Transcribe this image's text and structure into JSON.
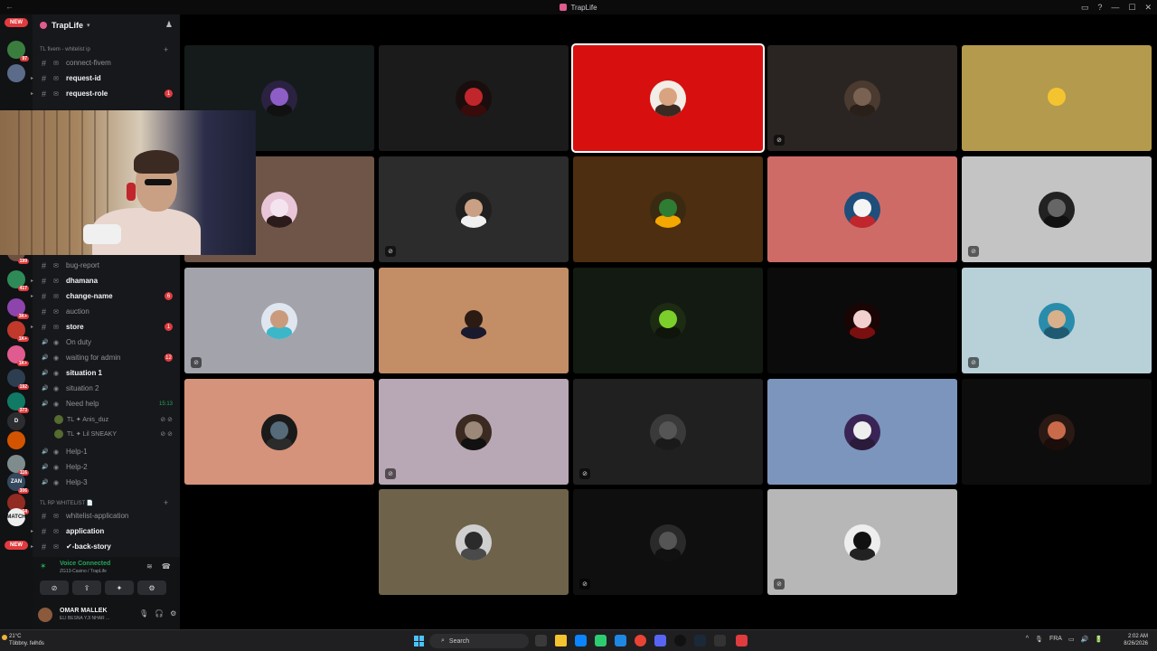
{
  "window": {
    "title": "TrapLife",
    "controls": [
      "▭",
      "?",
      "—",
      "☐",
      "✕"
    ],
    "back": "←"
  },
  "rail": {
    "new_top": "NEW",
    "new_bottom": "NEW",
    "servers": [
      {
        "badge": "97",
        "color": "#3b7d3e"
      },
      {
        "badge": "",
        "color": "#5b6b8a"
      },
      {
        "badge": "199",
        "color": "#6e5040"
      },
      {
        "badge": "417",
        "color": "#2e8b57"
      },
      {
        "badge": "3K+",
        "color": "#8e44ad"
      },
      {
        "badge": "1K+",
        "color": "#c0392b"
      },
      {
        "badge": "1K+",
        "color": "#e05b8f"
      },
      {
        "badge": "192",
        "color": "#2c3e50"
      },
      {
        "badge": "373",
        "color": "#117a65"
      },
      {
        "badge": "",
        "color": "#2b2d31",
        "label": "D"
      },
      {
        "badge": "",
        "color": "#d35400"
      },
      {
        "badge": "116",
        "color": "#7f8c8d"
      },
      {
        "badge": "306",
        "color": "#34495e",
        "label": "ZAN"
      },
      {
        "badge": "64",
        "color": "#922b21"
      },
      {
        "badge": "",
        "color": "#eee",
        "label": "MATCH"
      },
      {
        "badge": "160",
        "color": "#1e8449"
      }
    ]
  },
  "server": {
    "name": "TrapLife",
    "chevron": "▾",
    "add_member_icon": "♟"
  },
  "channels": [
    {
      "kind": "cat",
      "label": "TL fivem - whitelist ip",
      "plus": "+"
    },
    {
      "kind": "ch",
      "label": "connect-fivem",
      "bold": false,
      "ping": ""
    },
    {
      "kind": "ch",
      "label": "request-id",
      "bold": true,
      "ping": ""
    },
    {
      "kind": "ch",
      "label": "request-role",
      "bold": true,
      "ping": "1"
    },
    {
      "kind": "ch",
      "label": "bug-report",
      "bold": false,
      "ping": ""
    },
    {
      "kind": "ch",
      "label": "dhamana",
      "bold": true,
      "ping": ""
    },
    {
      "kind": "ch",
      "label": "change-name",
      "bold": true,
      "ping": "6"
    },
    {
      "kind": "ch",
      "label": "auction",
      "bold": false,
      "ping": ""
    },
    {
      "kind": "ch",
      "label": "store",
      "bold": true,
      "ping": "1"
    },
    {
      "kind": "voice",
      "label": "On duty",
      "bold": false,
      "ping": ""
    },
    {
      "kind": "voice",
      "label": "waiting for admin",
      "bold": false,
      "ping": "12"
    },
    {
      "kind": "voice",
      "label": "situation 1",
      "bold": true,
      "ping": ""
    },
    {
      "kind": "voice",
      "label": "situation 2",
      "bold": false,
      "ping": ""
    },
    {
      "kind": "voice",
      "label": "Need help",
      "bold": false,
      "ping": "",
      "timer": "15:13"
    },
    {
      "kind": "vuser",
      "label": "TL ✦ Anis_duz"
    },
    {
      "kind": "vuser",
      "label": "TL ✦ Lil SNEAKY"
    },
    {
      "kind": "voice",
      "label": "Help-1",
      "bold": false,
      "ping": ""
    },
    {
      "kind": "voice",
      "label": "Help-2",
      "bold": false,
      "ping": ""
    },
    {
      "kind": "voice",
      "label": "Help-3",
      "bold": false,
      "ping": ""
    },
    {
      "kind": "cat",
      "label": "TL RP WHITELIST 📄",
      "plus": "+"
    },
    {
      "kind": "ch",
      "label": "whitelist-application",
      "bold": false,
      "ping": ""
    },
    {
      "kind": "ch",
      "label": "application",
      "bold": true,
      "ping": ""
    },
    {
      "kind": "ch",
      "label": "✔-back-story",
      "bold": true,
      "ping": ""
    }
  ],
  "voice_panel": {
    "status": "Voice Connected",
    "location": "ZG13-Casino / TrapLife",
    "buttons": [
      "⊘",
      "⇪",
      "✦",
      "⚙"
    ]
  },
  "user": {
    "name": "OMAR MALLEK",
    "status": "ELI BESNA YJI NHAR ..."
  },
  "tiles": [
    {
      "bg": "#151b1a",
      "av1": "#2b2140",
      "av2": "#8e5ec7",
      "av3": "#111",
      "video": false,
      "speaking": false
    },
    {
      "bg": "#1b1b1b",
      "av1": "#1a0d0d",
      "av2": "#c0262b",
      "av3": "#3a0b0b",
      "video": false,
      "speaking": false
    },
    {
      "bg": "#d80f0f",
      "av1": "#f2ede6",
      "av2": "#d9a37f",
      "av3": "#3b2a22",
      "video": false,
      "speaking": true
    },
    {
      "bg": "#2a2522",
      "av1": "#4b3a30",
      "av2": "#7a6253",
      "av3": "#2a201a",
      "video": true,
      "speaking": false
    },
    {
      "bg": "#b49a4c",
      "av1": "#b49a4c",
      "av2": "#f4c430",
      "av3": "#b49a4c",
      "video": false,
      "speaking": false
    },
    {
      "bg": "#6e5547",
      "av1": "#e8c6d8",
      "av2": "#f4e4f0",
      "av3": "#2b1b1b",
      "video": false,
      "speaking": false
    },
    {
      "bg": "#2c2c2c",
      "av1": "#1f1f1f",
      "av2": "#c9a084",
      "av3": "#f0f0f0",
      "video": true,
      "speaking": false
    },
    {
      "bg": "#4d2e10",
      "av1": "#3a2a12",
      "av2": "#2e7d32",
      "av3": "#f4a700",
      "video": false,
      "speaking": false
    },
    {
      "bg": "#cf6b67",
      "av1": "#1e4e79",
      "av2": "#f4f4f4",
      "av3": "#c0262b",
      "video": false,
      "speaking": false
    },
    {
      "bg": "#c4c4c4",
      "av1": "#222",
      "av2": "#666",
      "av3": "#111",
      "video": true,
      "speaking": false
    },
    {
      "bg": "#a3a3ab",
      "av1": "#e0e6ef",
      "av2": "#c99b7c",
      "av3": "#3cb6c9",
      "video": true,
      "speaking": false
    },
    {
      "bg": "#c38d66",
      "av1": "#c38d66",
      "av2": "#2b1b12",
      "av3": "#1a1a2e",
      "video": false,
      "speaking": false
    },
    {
      "bg": "#121a12",
      "av1": "#1c2b12",
      "av2": "#7ccf2a",
      "av3": "#0f150a",
      "video": false,
      "speaking": false
    },
    {
      "bg": "#0b0b0b",
      "av1": "#1a0505",
      "av2": "#f2d0d0",
      "av3": "#7a0f0f",
      "video": false,
      "speaking": false
    },
    {
      "bg": "#b8d0d8",
      "av1": "#2a8cab",
      "av2": "#d9b08c",
      "av3": "#1e5b73",
      "video": true,
      "speaking": false
    },
    {
      "bg": "#d4937a",
      "av1": "#1a1a1a",
      "av2": "#556b7a",
      "av3": "#2b2b2b",
      "video": false,
      "speaking": false
    },
    {
      "bg": "#b8a7b4",
      "av1": "#3a2a22",
      "av2": "#9b8878",
      "av3": "#111",
      "video": true,
      "speaking": false
    },
    {
      "bg": "#202020",
      "av1": "#3a3a3a",
      "av2": "#555",
      "av3": "#1a1a1a",
      "video": true,
      "speaking": false
    },
    {
      "bg": "#7c95bc",
      "av1": "#3a2456",
      "av2": "#eee",
      "av3": "#2b1b3a",
      "video": false,
      "speaking": false
    },
    {
      "bg": "#0d0d0d",
      "av1": "#2b1a14",
      "av2": "#c96b4a",
      "av3": "#1a0d0a",
      "video": false,
      "speaking": false
    },
    {
      "bg": "#6e634a",
      "av1": "#cfcfcf",
      "av2": "#2b2b2b",
      "av3": "#4a4a4a",
      "video": false,
      "speaking": false
    },
    {
      "bg": "#0f0f0f",
      "av1": "#2a2a2a",
      "av2": "#555",
      "av3": "#111",
      "video": true,
      "speaking": false
    },
    {
      "bg": "#b7b7b7",
      "av1": "#eee",
      "av2": "#111",
      "av3": "#222",
      "video": true,
      "speaking": false
    }
  ],
  "taskbar": {
    "weather_temp": "21°C",
    "weather_desc": "Többny. felhős",
    "search_placeholder": "Search",
    "tray": [
      "^",
      "🎙",
      "FRA",
      "▭",
      "🔊",
      "🔋"
    ],
    "time": "2:02 AM",
    "date": "8/26/2026",
    "app_colors": [
      "#3a3a3a",
      "#f4c430",
      "#0a84ff",
      "#2ecc71",
      "#1e88e5",
      "#ea4335",
      "#5865f2",
      "#111",
      "#1b2838",
      "#333",
      "#e03b3e"
    ]
  }
}
